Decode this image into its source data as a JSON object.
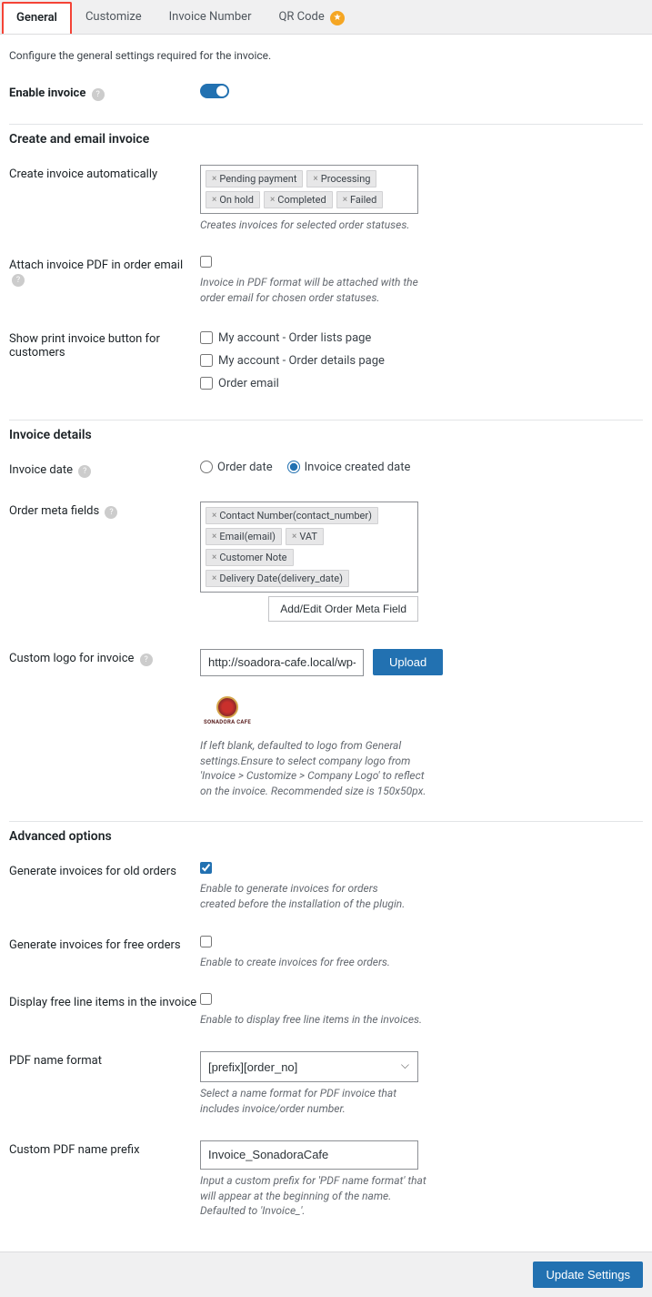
{
  "tabs": {
    "general": "General",
    "customize": "Customize",
    "invoice_number": "Invoice Number",
    "qr_code": "QR Code"
  },
  "intro": "Configure the general settings required for the invoice.",
  "enable_invoice": {
    "label": "Enable invoice"
  },
  "section_create_email": "Create and email invoice",
  "create_auto": {
    "label": "Create invoice automatically",
    "tags": {
      "t1": "Pending payment",
      "t2": "Processing",
      "t3": "On hold",
      "t4": "Completed",
      "t5": "Failed"
    },
    "helper": "Creates invoices for selected order statuses."
  },
  "attach_pdf": {
    "label": "Attach invoice PDF in order email",
    "helper": "Invoice in PDF format will be attached with the order email for chosen order statuses."
  },
  "show_print": {
    "label": "Show print invoice button for customers",
    "opt1": "My account - Order lists page",
    "opt2": "My account - Order details page",
    "opt3": "Order email"
  },
  "section_invoice_details": "Invoice details",
  "invoice_date": {
    "label": "Invoice date",
    "opt1": "Order date",
    "opt2": "Invoice created date"
  },
  "order_meta": {
    "label": "Order meta fields",
    "tags": {
      "t1": "Contact Number(contact_number)",
      "t2": "Email(email)",
      "t3": "VAT",
      "t4": "Customer Note",
      "t5": "Delivery Date(delivery_date)"
    },
    "add_btn": "Add/Edit Order Meta Field"
  },
  "custom_logo": {
    "label": "Custom logo for invoice",
    "url": "http://soadora-cafe.local/wp-content/up",
    "upload": "Upload",
    "logo_text": "SONADORA CAFE",
    "helper": "If left blank, defaulted to logo from General settings.Ensure to select company logo from 'Invoice > Customize > Company Logo' to reflect on the invoice. Recommended size is 150x50px."
  },
  "section_advanced": "Advanced options",
  "gen_old": {
    "label": "Generate invoices for old orders",
    "helper": "Enable to generate invoices for orders created before the installation of the plugin."
  },
  "gen_free": {
    "label": "Generate invoices for free orders",
    "helper": "Enable to create invoices for free orders."
  },
  "display_free": {
    "label": "Display free line items in the invoice",
    "helper": "Enable to display free line items in the invoices."
  },
  "pdf_format": {
    "label": "PDF name format",
    "value": "[prefix][order_no]",
    "helper": "Select a name format for PDF invoice that includes invoice/order number."
  },
  "pdf_prefix": {
    "label": "Custom PDF name prefix",
    "value": "Invoice_SonadoraCafe",
    "helper": "Input a custom prefix for 'PDF name format' that will appear at the beginning of the name. Defaulted to 'Invoice_'."
  },
  "footer": {
    "update": "Update Settings"
  }
}
